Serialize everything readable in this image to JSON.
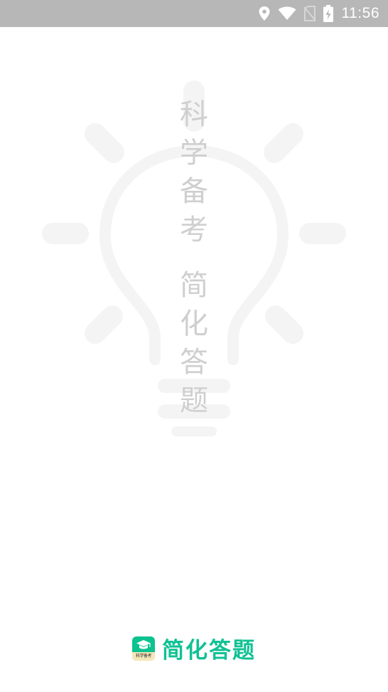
{
  "status_bar": {
    "time": "11:56",
    "icons": [
      "location-icon",
      "wifi-icon",
      "no-sim-icon",
      "battery-charging-icon"
    ]
  },
  "splash": {
    "slogan_top": [
      "科",
      "学",
      "备",
      "考"
    ],
    "slogan_bottom": [
      "简",
      "化",
      "答",
      "题"
    ]
  },
  "brand": {
    "icon_label": "科学备考",
    "name": "简化答题",
    "color": "#10c193"
  },
  "colors": {
    "status_bar_bg": "#b7b7b7",
    "watermark": "#f4f4f4",
    "watermark_text": "#cfcfcf",
    "accent": "#0cc28f"
  }
}
